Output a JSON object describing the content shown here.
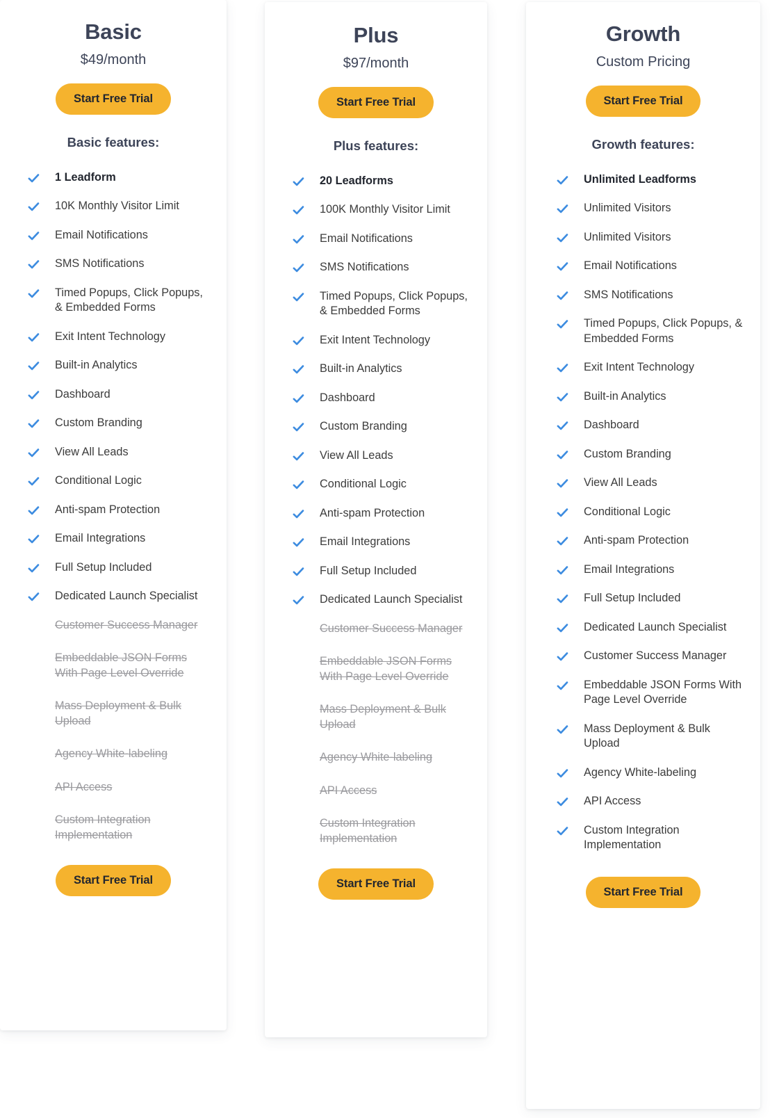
{
  "plans": [
    {
      "name": "Basic",
      "price": "$49/month",
      "cta_top_label": "Start Free Trial",
      "cta_bottom_label": "Start Free Trial",
      "features_heading": "Basic features:",
      "features": [
        {
          "label": "1 Leadform",
          "included": true,
          "emphasis": true
        },
        {
          "label": "10K Monthly Visitor Limit",
          "included": true,
          "emphasis": false
        },
        {
          "label": "Email Notifications",
          "included": true,
          "emphasis": false
        },
        {
          "label": "SMS Notifications",
          "included": true,
          "emphasis": false
        },
        {
          "label": "Timed Popups, Click Popups, & Embedded Forms",
          "included": true,
          "emphasis": false
        },
        {
          "label": "Exit Intent Technology",
          "included": true,
          "emphasis": false
        },
        {
          "label": "Built-in Analytics",
          "included": true,
          "emphasis": false
        },
        {
          "label": "Dashboard",
          "included": true,
          "emphasis": false
        },
        {
          "label": "Custom Branding",
          "included": true,
          "emphasis": false
        },
        {
          "label": "View All Leads",
          "included": true,
          "emphasis": false
        },
        {
          "label": "Conditional Logic",
          "included": true,
          "emphasis": false
        },
        {
          "label": "Anti-spam Protection",
          "included": true,
          "emphasis": false
        },
        {
          "label": "Email Integrations",
          "included": true,
          "emphasis": false
        },
        {
          "label": "Full Setup Included",
          "included": true,
          "emphasis": false
        },
        {
          "label": "Dedicated Launch Specialist",
          "included": true,
          "emphasis": false
        },
        {
          "label": "Customer Success Manager",
          "included": false,
          "emphasis": false
        },
        {
          "label": "Embeddable JSON Forms With Page Level Override",
          "included": false,
          "emphasis": false
        },
        {
          "label": "Mass Deployment & Bulk Upload",
          "included": false,
          "emphasis": false
        },
        {
          "label": "Agency White-labeling",
          "included": false,
          "emphasis": false
        },
        {
          "label": "API Access",
          "included": false,
          "emphasis": false
        },
        {
          "label": "Custom Integration Implementation",
          "included": false,
          "emphasis": false
        }
      ]
    },
    {
      "name": "Plus",
      "price": "$97/month",
      "cta_top_label": "Start Free Trial",
      "cta_bottom_label": "Start Free Trial",
      "features_heading": "Plus features:",
      "features": [
        {
          "label": "20 Leadforms",
          "included": true,
          "emphasis": true
        },
        {
          "label": "100K Monthly Visitor Limit",
          "included": true,
          "emphasis": false
        },
        {
          "label": "Email Notifications",
          "included": true,
          "emphasis": false
        },
        {
          "label": "SMS Notifications",
          "included": true,
          "emphasis": false
        },
        {
          "label": "Timed Popups, Click Popups, & Embedded Forms",
          "included": true,
          "emphasis": false
        },
        {
          "label": "Exit Intent Technology",
          "included": true,
          "emphasis": false
        },
        {
          "label": "Built-in Analytics",
          "included": true,
          "emphasis": false
        },
        {
          "label": "Dashboard",
          "included": true,
          "emphasis": false
        },
        {
          "label": "Custom Branding",
          "included": true,
          "emphasis": false
        },
        {
          "label": "View All Leads",
          "included": true,
          "emphasis": false
        },
        {
          "label": "Conditional Logic",
          "included": true,
          "emphasis": false
        },
        {
          "label": "Anti-spam Protection",
          "included": true,
          "emphasis": false
        },
        {
          "label": "Email Integrations",
          "included": true,
          "emphasis": false
        },
        {
          "label": "Full Setup Included",
          "included": true,
          "emphasis": false
        },
        {
          "label": "Dedicated Launch Specialist",
          "included": true,
          "emphasis": false
        },
        {
          "label": "Customer Success Manager",
          "included": false,
          "emphasis": false
        },
        {
          "label": "Embeddable JSON Forms With Page Level Override",
          "included": false,
          "emphasis": false
        },
        {
          "label": "Mass Deployment & Bulk Upload",
          "included": false,
          "emphasis": false
        },
        {
          "label": "Agency White-labeling",
          "included": false,
          "emphasis": false
        },
        {
          "label": "API Access",
          "included": false,
          "emphasis": false
        },
        {
          "label": "Custom Integration Implementation",
          "included": false,
          "emphasis": false
        }
      ]
    },
    {
      "name": "Growth",
      "price": "Custom Pricing",
      "cta_top_label": "Start Free Trial",
      "cta_bottom_label": "Start Free Trial",
      "features_heading": "Growth features:",
      "features": [
        {
          "label": "Unlimited Leadforms",
          "included": true,
          "emphasis": true
        },
        {
          "label": "Unlimited Visitors",
          "included": true,
          "emphasis": false
        },
        {
          "label": "Unlimited Visitors",
          "included": true,
          "emphasis": false
        },
        {
          "label": "Email Notifications",
          "included": true,
          "emphasis": false
        },
        {
          "label": "SMS Notifications",
          "included": true,
          "emphasis": false
        },
        {
          "label": "Timed Popups, Click Popups, & Embedded Forms",
          "included": true,
          "emphasis": false
        },
        {
          "label": "Exit Intent Technology",
          "included": true,
          "emphasis": false
        },
        {
          "label": "Built-in Analytics",
          "included": true,
          "emphasis": false
        },
        {
          "label": "Dashboard",
          "included": true,
          "emphasis": false
        },
        {
          "label": "Custom Branding",
          "included": true,
          "emphasis": false
        },
        {
          "label": "View All Leads",
          "included": true,
          "emphasis": false
        },
        {
          "label": "Conditional Logic",
          "included": true,
          "emphasis": false
        },
        {
          "label": "Anti-spam Protection",
          "included": true,
          "emphasis": false
        },
        {
          "label": "Email Integrations",
          "included": true,
          "emphasis": false
        },
        {
          "label": "Full Setup Included",
          "included": true,
          "emphasis": false
        },
        {
          "label": "Dedicated Launch Specialist",
          "included": true,
          "emphasis": false
        },
        {
          "label": "Customer Success Manager",
          "included": true,
          "emphasis": false
        },
        {
          "label": "Embeddable JSON Forms With Page Level Override",
          "included": true,
          "emphasis": false
        },
        {
          "label": "Mass Deployment & Bulk Upload",
          "included": true,
          "emphasis": false
        },
        {
          "label": "Agency White-labeling",
          "included": true,
          "emphasis": false
        },
        {
          "label": "API Access",
          "included": true,
          "emphasis": false
        },
        {
          "label": "Custom Integration Implementation",
          "included": true,
          "emphasis": false
        }
      ]
    }
  ],
  "icons": {
    "check": "check-icon"
  },
  "colors": {
    "cta_background": "#f5b32e",
    "cta_text": "#22262f",
    "check": "#3d8ce0",
    "heading": "#3d4458",
    "feature_text": "#3c3c3c",
    "disabled_text": "#9a9a9e",
    "card_background": "#ffffff",
    "page_background": "#ffffff"
  }
}
